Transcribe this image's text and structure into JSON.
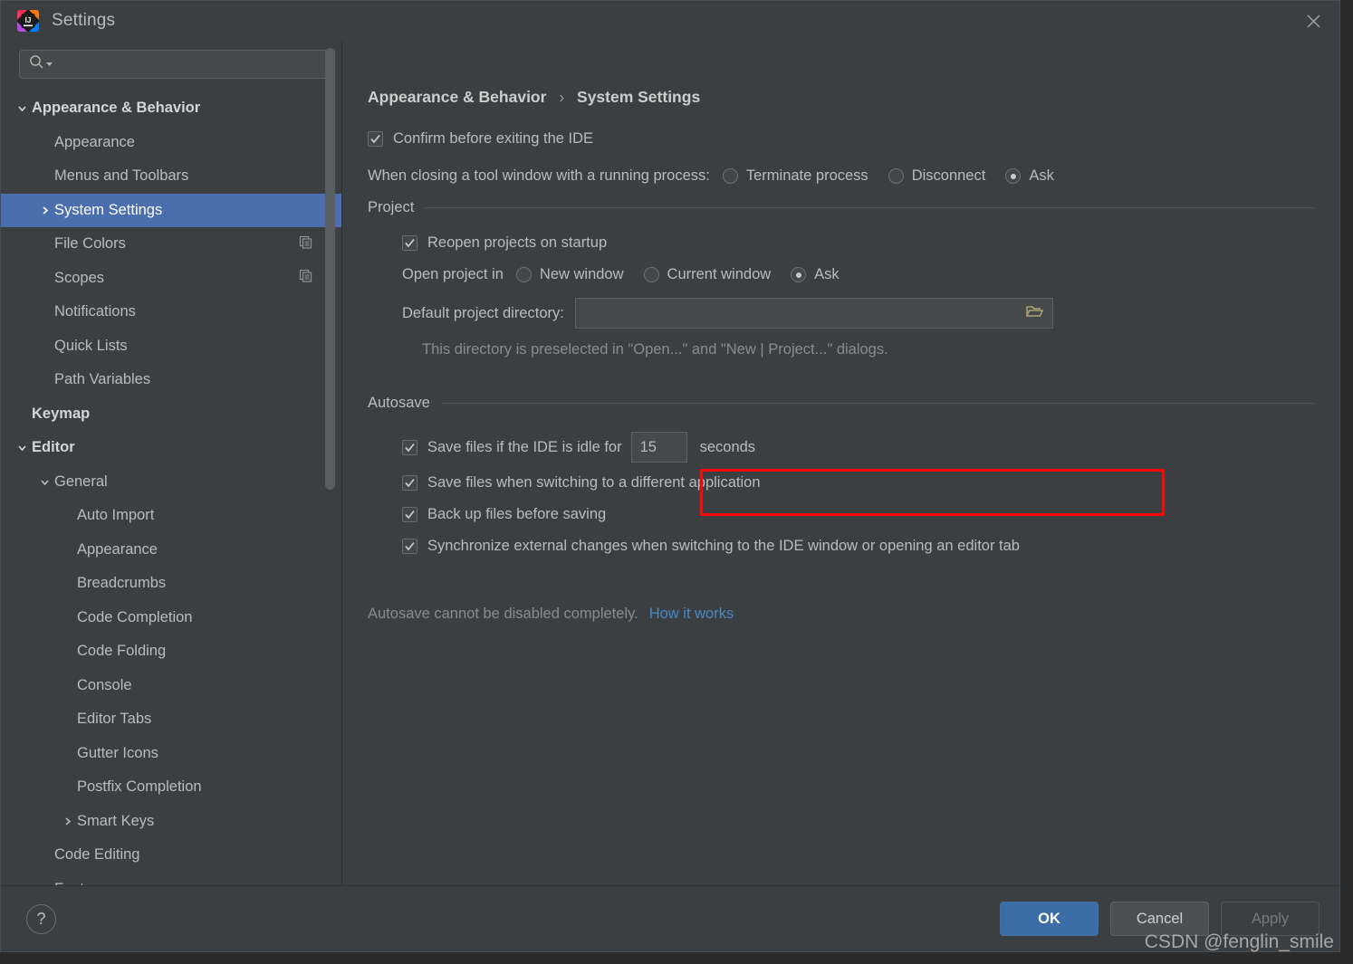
{
  "window": {
    "title": "Settings",
    "logo_icon": "intellij-idea-logo",
    "close_icon": "close-icon"
  },
  "sidebar": {
    "search": {
      "placeholder": "",
      "value": "",
      "icon": "search-icon",
      "caret_icon": "chevron-down-icon"
    },
    "items": [
      {
        "label": "Appearance & Behavior",
        "indent": 0,
        "twisty": "chevron-down-icon",
        "bold": true,
        "selected": false,
        "right_icon": ""
      },
      {
        "label": "Appearance",
        "indent": 1,
        "twisty": "",
        "bold": false,
        "selected": false,
        "right_icon": ""
      },
      {
        "label": "Menus and Toolbars",
        "indent": 1,
        "twisty": "",
        "bold": false,
        "selected": false,
        "right_icon": ""
      },
      {
        "label": "System Settings",
        "indent": 1,
        "twisty": "chevron-right-icon",
        "bold": false,
        "selected": true,
        "right_icon": ""
      },
      {
        "label": "File Colors",
        "indent": 1,
        "twisty": "",
        "bold": false,
        "selected": false,
        "right_icon": "copy-icon"
      },
      {
        "label": "Scopes",
        "indent": 1,
        "twisty": "",
        "bold": false,
        "selected": false,
        "right_icon": "copy-icon"
      },
      {
        "label": "Notifications",
        "indent": 1,
        "twisty": "",
        "bold": false,
        "selected": false,
        "right_icon": ""
      },
      {
        "label": "Quick Lists",
        "indent": 1,
        "twisty": "",
        "bold": false,
        "selected": false,
        "right_icon": ""
      },
      {
        "label": "Path Variables",
        "indent": 1,
        "twisty": "",
        "bold": false,
        "selected": false,
        "right_icon": ""
      },
      {
        "label": "Keymap",
        "indent": 0,
        "twisty": "",
        "bold": true,
        "selected": false,
        "right_icon": ""
      },
      {
        "label": "Editor",
        "indent": 0,
        "twisty": "chevron-down-icon",
        "bold": true,
        "selected": false,
        "right_icon": ""
      },
      {
        "label": "General",
        "indent": 1,
        "twisty": "chevron-down-icon",
        "bold": false,
        "selected": false,
        "right_icon": ""
      },
      {
        "label": "Auto Import",
        "indent": 2,
        "twisty": "",
        "bold": false,
        "selected": false,
        "right_icon": ""
      },
      {
        "label": "Appearance",
        "indent": 2,
        "twisty": "",
        "bold": false,
        "selected": false,
        "right_icon": ""
      },
      {
        "label": "Breadcrumbs",
        "indent": 2,
        "twisty": "",
        "bold": false,
        "selected": false,
        "right_icon": ""
      },
      {
        "label": "Code Completion",
        "indent": 2,
        "twisty": "",
        "bold": false,
        "selected": false,
        "right_icon": ""
      },
      {
        "label": "Code Folding",
        "indent": 2,
        "twisty": "",
        "bold": false,
        "selected": false,
        "right_icon": ""
      },
      {
        "label": "Console",
        "indent": 2,
        "twisty": "",
        "bold": false,
        "selected": false,
        "right_icon": ""
      },
      {
        "label": "Editor Tabs",
        "indent": 2,
        "twisty": "",
        "bold": false,
        "selected": false,
        "right_icon": ""
      },
      {
        "label": "Gutter Icons",
        "indent": 2,
        "twisty": "",
        "bold": false,
        "selected": false,
        "right_icon": ""
      },
      {
        "label": "Postfix Completion",
        "indent": 2,
        "twisty": "",
        "bold": false,
        "selected": false,
        "right_icon": ""
      },
      {
        "label": "Smart Keys",
        "indent": 2,
        "twisty": "chevron-right-icon",
        "bold": false,
        "selected": false,
        "right_icon": ""
      },
      {
        "label": "Code Editing",
        "indent": 1,
        "twisty": "",
        "bold": false,
        "selected": false,
        "right_icon": ""
      },
      {
        "label": "Font",
        "indent": 1,
        "twisty": "",
        "bold": false,
        "selected": false,
        "right_icon": ""
      }
    ]
  },
  "breadcrumb": {
    "parent": "Appearance & Behavior",
    "separator": "›",
    "current": "System Settings"
  },
  "main": {
    "confirm_exit": {
      "label": "Confirm before exiting the IDE",
      "checked": true
    },
    "closing_tool_window": {
      "label": "When closing a tool window with a running process:",
      "options": [
        "Terminate process",
        "Disconnect",
        "Ask"
      ],
      "selected": "Ask"
    },
    "project": {
      "group_title": "Project",
      "reopen": {
        "label": "Reopen projects on startup",
        "checked": true
      },
      "open_project_in": {
        "label": "Open project in",
        "options": [
          "New window",
          "Current window",
          "Ask"
        ],
        "selected": "Ask"
      },
      "default_dir": {
        "label": "Default project directory:",
        "value": "",
        "placeholder": "",
        "browse_icon": "folder-icon"
      },
      "dir_hint": "This directory is preselected in \"Open...\" and \"New | Project...\" dialogs."
    },
    "autosave": {
      "group_title": "Autosave",
      "idle": {
        "label_before": "Save files if the IDE is idle for",
        "seconds_value": "15",
        "label_after": "seconds",
        "checked": true,
        "highlighted": true
      },
      "switch_app": {
        "label": "Save files when switching to a different application",
        "checked": true
      },
      "backup": {
        "label": "Back up files before saving",
        "checked": true
      },
      "sync": {
        "label": "Synchronize external changes when switching to the IDE window or opening an editor tab",
        "checked": true
      },
      "note": "Autosave cannot be disabled completely.",
      "note_link": "How it works"
    }
  },
  "footer": {
    "help_label": "?",
    "ok_label": "OK",
    "cancel_label": "Cancel",
    "apply_label": "Apply"
  },
  "watermark": "CSDN @fenglin_smile",
  "colors": {
    "window_bg": "#3c3f41",
    "selection_blue": "#4b6eaf",
    "primary_button": "#3b6ea8",
    "link_blue": "#4a88c7",
    "highlight_red": "#fb0707",
    "text": "#bbbbbb",
    "muted_text": "#8b8b8b"
  }
}
